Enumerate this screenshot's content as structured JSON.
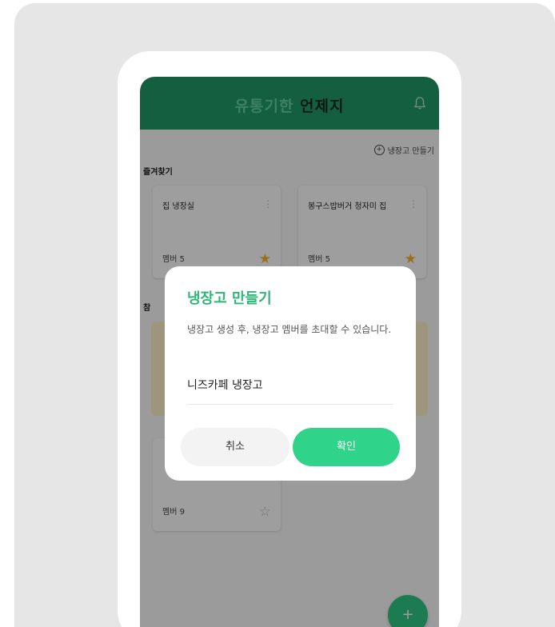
{
  "app": {
    "title_part1": "유통기한",
    "title_part2": "언제지"
  },
  "make_fridge_link": "냉장고 만들기",
  "favorites_label": "즐겨찾기",
  "participating_label_partial": "참",
  "cards": [
    {
      "title": "집 냉장실",
      "member": "멤버 5",
      "favorite": true
    },
    {
      "title": "봉구스밥버거 청자미 집",
      "member": "멤버 5",
      "favorite": true
    },
    {
      "title": "",
      "member": "멤버 9",
      "favorite": false
    }
  ],
  "dialog": {
    "title": "냉장고 만들기",
    "description": "냉장고 생성 후, 냉장고 멤버를 초대할 수 있습니다.",
    "input_value": "니즈카페 냉장고",
    "cancel_label": "취소",
    "confirm_label": "확인"
  },
  "fab_label": "+",
  "colors": {
    "brand_green": "#229a6a",
    "accent_green": "#2fd38a",
    "star_yellow": "#f2b62b"
  }
}
